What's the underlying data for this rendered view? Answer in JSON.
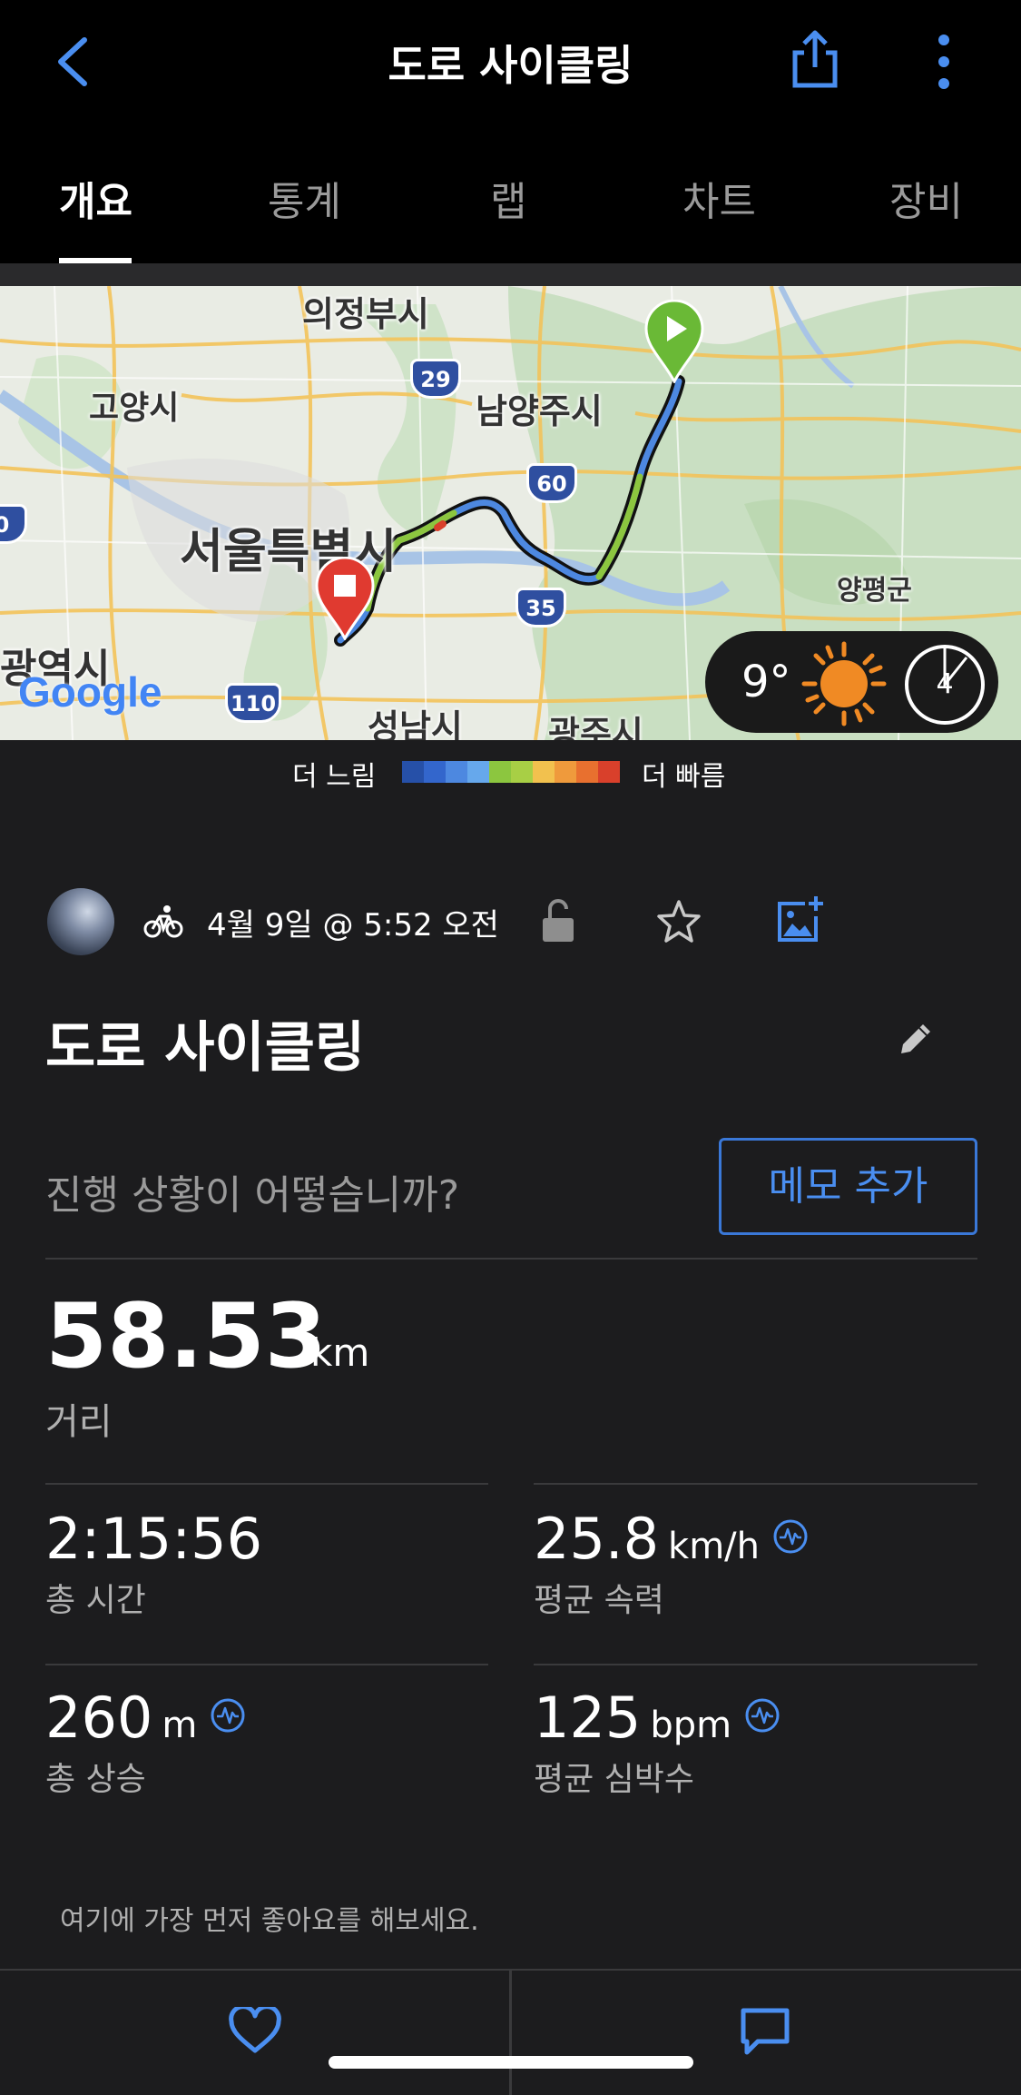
{
  "header": {
    "title": "도로 사이클링",
    "back_icon": "chevron-left-icon",
    "share_icon": "share-icon",
    "more_icon": "more-vertical-icon"
  },
  "tabs": [
    {
      "label": "개요",
      "active": true
    },
    {
      "label": "통계",
      "active": false
    },
    {
      "label": "랩",
      "active": false
    },
    {
      "label": "차트",
      "active": false
    },
    {
      "label": "장비",
      "active": false
    }
  ],
  "map": {
    "labels": {
      "uijeongbu": "의정부시",
      "goyang": "고양시",
      "namyangju": "남양주시",
      "seoul": "서울특별시",
      "yangpyeong": "양평군",
      "gwangyeok": "광역시",
      "seongnam": "성남시",
      "gwangju": "광주시"
    },
    "shields": {
      "r29": "29",
      "r60": "60",
      "r35": "35",
      "r110": "110",
      "r0": "0"
    },
    "attribution": "Google",
    "weather": {
      "temperature": "9°",
      "condition_icon": "sun-icon",
      "wind_speed": "4"
    }
  },
  "legend": {
    "slow_label": "더 느림",
    "fast_label": "더 빠름",
    "colors": [
      "#2650a8",
      "#3366cc",
      "#4d88e0",
      "#66a8ec",
      "#8cc63f",
      "#a8cf45",
      "#f2c14e",
      "#ef9a3c",
      "#e8702f",
      "#d9402b"
    ]
  },
  "activity": {
    "date": "4월 9일 @ 5:52 오전",
    "name": "도로 사이클링",
    "memo_prompt": "진행 상황이 어떻습니까?",
    "memo_button": "메모 추가"
  },
  "stats": {
    "distance": {
      "value": "58.53",
      "unit": "km",
      "label": "거리"
    },
    "total_time": {
      "value": "2:15:56",
      "label": "총 시간"
    },
    "avg_speed": {
      "value": "25.8",
      "unit": "km/h",
      "label": "평균 속력"
    },
    "total_ascent": {
      "value": "260",
      "unit": "m",
      "label": "총 상승"
    },
    "avg_hr": {
      "value": "125",
      "unit": "bpm",
      "label": "평균 심박수"
    }
  },
  "social": {
    "like_prompt": "여기에 가장 먼저 좋아요를 해보세요."
  },
  "colors": {
    "accent": "#3a78d8",
    "background": "#1c1c1e",
    "header_bg": "#000000"
  }
}
